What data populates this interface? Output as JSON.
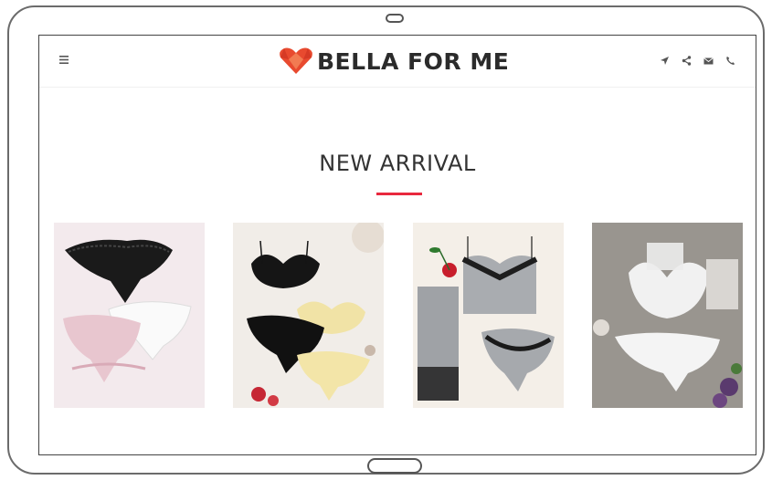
{
  "brand": {
    "name": "BELLA FOR ME",
    "accent_color": "#e8283e",
    "logo_icon": "heart-diamond-logo-icon"
  },
  "header": {
    "menu_icon": "hamburger-menu-icon",
    "right_icons": [
      "location-arrow-icon",
      "share-icon",
      "mail-icon",
      "phone-icon"
    ]
  },
  "section": {
    "title": "NEW ARRIVAL"
  },
  "products": [
    {
      "image": "product-image-lace-panties-set"
    },
    {
      "image": "product-image-bra-and-panties-flatlay"
    },
    {
      "image": "product-image-gray-lace-cami-set"
    },
    {
      "image": "product-image-white-lace-lingerie-set"
    }
  ]
}
